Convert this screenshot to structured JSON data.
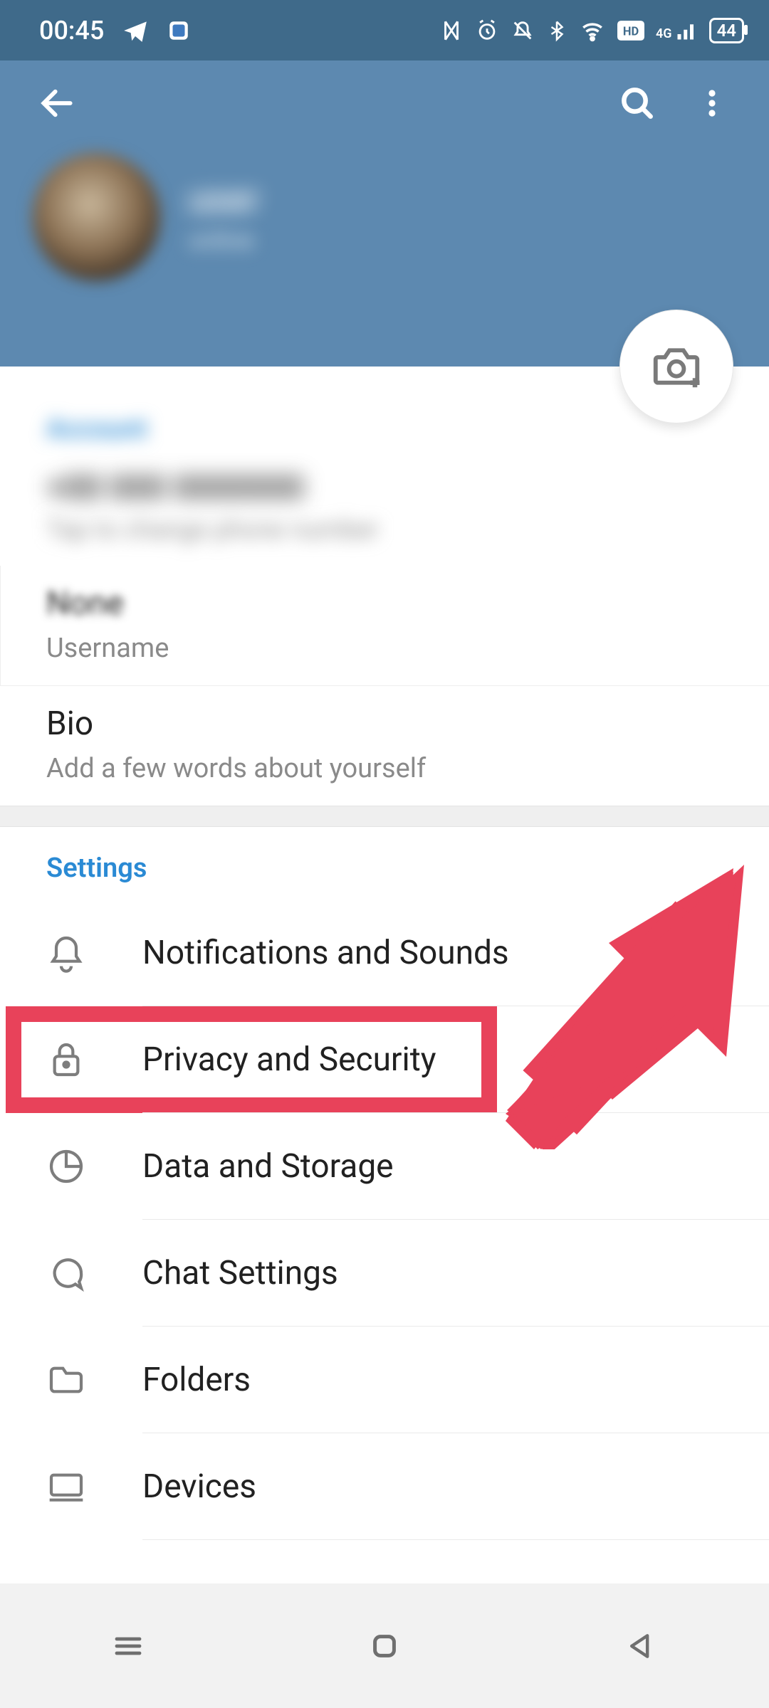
{
  "status": {
    "time": "00:45",
    "network_label": "4G",
    "battery_percent": "44"
  },
  "profile": {
    "name": "user",
    "status": "online"
  },
  "account": {
    "section_title": "Account",
    "phone_value": "+00 000 0000000",
    "phone_hint": "Tap to change phone number",
    "username_value": "None",
    "username_label": "Username",
    "bio_value": "Bio",
    "bio_hint": "Add a few words about yourself"
  },
  "settings": {
    "section_title": "Settings",
    "items": [
      {
        "label": "Notifications and Sounds"
      },
      {
        "label": "Privacy and Security"
      },
      {
        "label": "Data and Storage"
      },
      {
        "label": "Chat Settings"
      },
      {
        "label": "Folders"
      },
      {
        "label": "Devices"
      }
    ]
  }
}
